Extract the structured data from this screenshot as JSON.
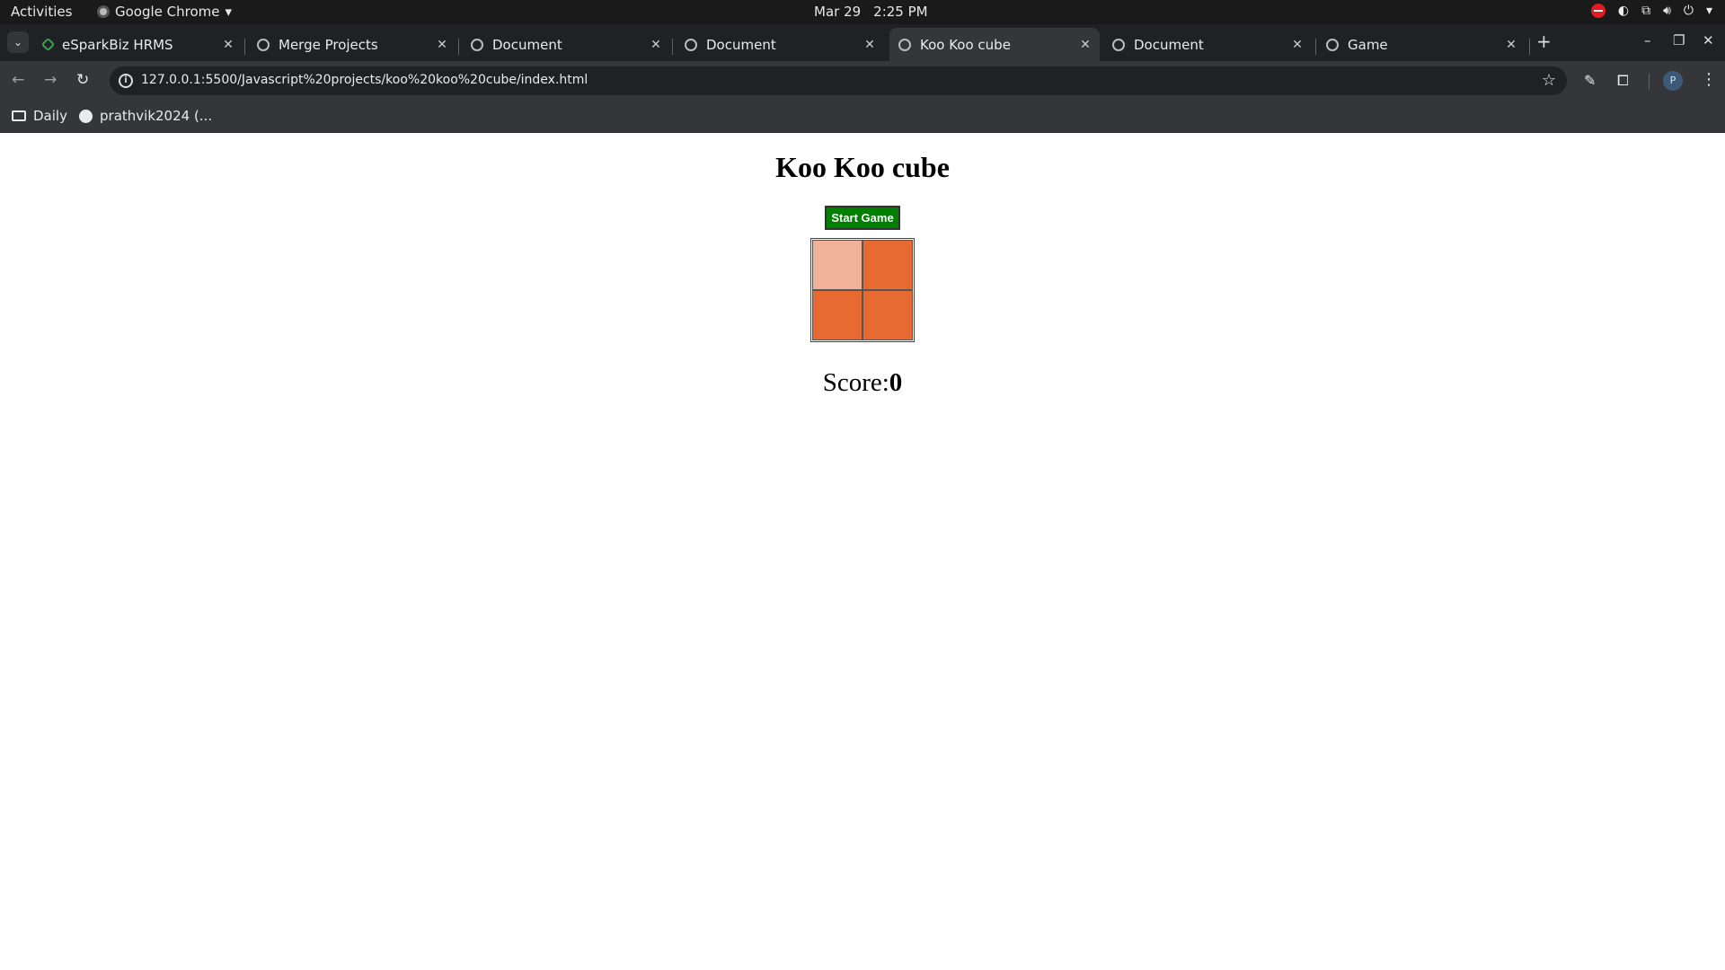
{
  "system_bar": {
    "activities": "Activities",
    "app_name": "Google Chrome",
    "date": "Mar 29",
    "time": "2:25 PM"
  },
  "tabs": [
    {
      "title": "eSparkBiz HRMS",
      "active": false
    },
    {
      "title": "Merge Projects",
      "active": false
    },
    {
      "title": "Document",
      "active": false
    },
    {
      "title": "Document",
      "active": false
    },
    {
      "title": "Koo Koo cube",
      "active": true
    },
    {
      "title": "Document",
      "active": false
    },
    {
      "title": "Game",
      "active": false
    }
  ],
  "address_bar": {
    "url": "127.0.0.1:5500/Javascript%20projects/koo%20koo%20cube/index.html"
  },
  "bookmarks": [
    {
      "label": "Daily",
      "icon": "folder-icon"
    },
    {
      "label": "prathvik2024 (...",
      "icon": "github-icon"
    }
  ],
  "page": {
    "title": "Koo Koo cube",
    "start_button": "Start Game",
    "score_label": "Score:",
    "score_value": "0",
    "cells": [
      {
        "color": "#f2b299",
        "state": "highlighted"
      },
      {
        "color": "#e86a33",
        "state": "normal"
      },
      {
        "color": "#e86a33",
        "state": "normal"
      },
      {
        "color": "#e86a33",
        "state": "normal"
      }
    ]
  },
  "profile_initial": "P",
  "colors": {
    "start_button": "#008000",
    "cell_base": "#e86a33",
    "cell_highlight": "#f2b299"
  }
}
